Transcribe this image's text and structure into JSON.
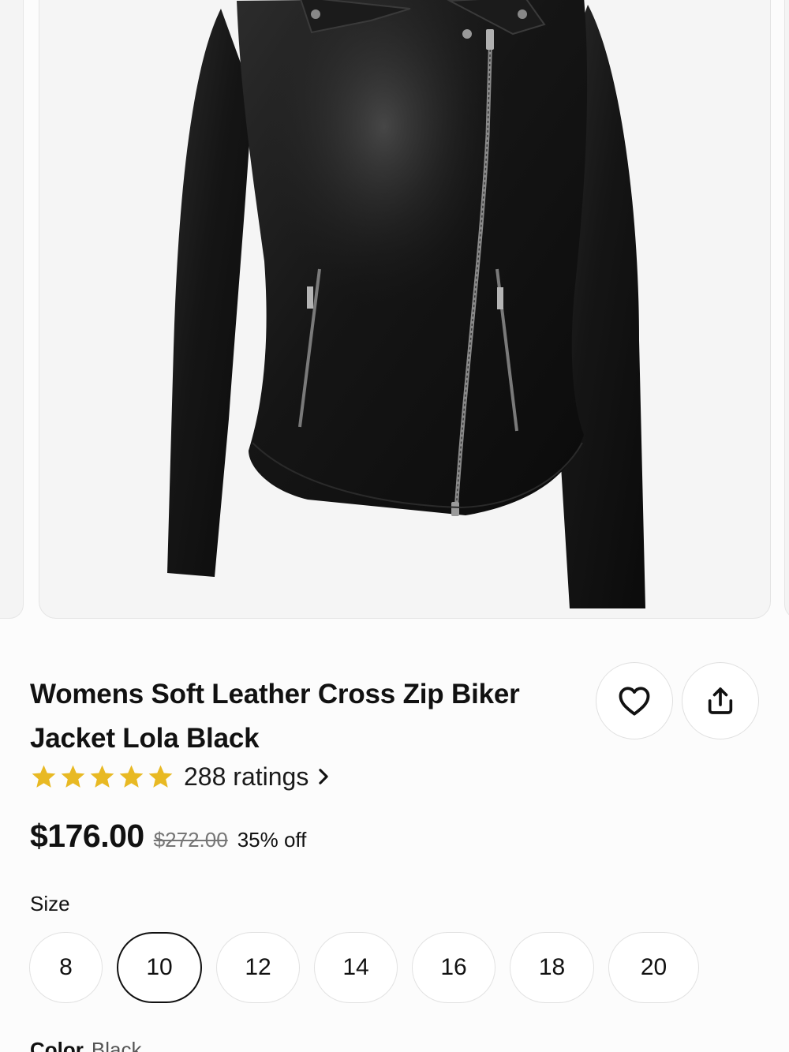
{
  "product": {
    "title": "Womens Soft Leather Cross Zip Biker Jacket Lola Black",
    "image_icon": "leather-jacket-image"
  },
  "actions": {
    "favorite_icon": "heart-icon",
    "share_icon": "share-icon"
  },
  "rating": {
    "stars": 5,
    "label": "288 ratings",
    "star_color": "#e8b923",
    "chevron_icon": "chevron-right-icon"
  },
  "pricing": {
    "price": "$176.00",
    "original_price": "$272.00",
    "discount": "35% off"
  },
  "size": {
    "label": "Size",
    "options": [
      "8",
      "10",
      "12",
      "14",
      "16",
      "18",
      "20"
    ],
    "selected": "10"
  },
  "color": {
    "label": "Color",
    "value": "Black"
  }
}
